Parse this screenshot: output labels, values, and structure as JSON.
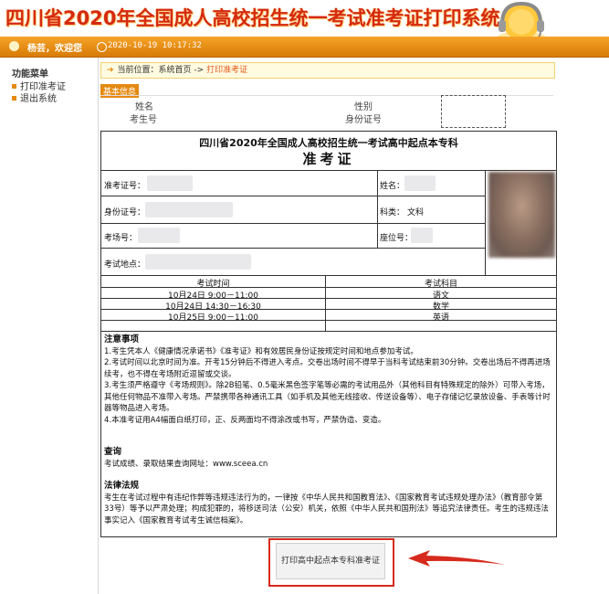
{
  "header": {
    "system_title": "四川省2020年全国成人高校招生统一考试准考证打印系统",
    "welcome": "杨芸，欢迎您",
    "datetime": "2020-10-19 10:17:32"
  },
  "sidebar": {
    "title": "功能菜单",
    "items": [
      {
        "label": "打印准考证"
      },
      {
        "label": "退出系统"
      }
    ]
  },
  "breadcrumb": {
    "prefix": "当前位置：系统首页 ->",
    "current": "打印准考证"
  },
  "basic_info": {
    "section_label": "基本信息",
    "name_label": "姓名",
    "exam_no_label": "考生号",
    "gender_label": "性别",
    "id_label": "身份证号"
  },
  "certificate": {
    "title": "四川省2020年全国成人高校招生统一考试高中起点本专科",
    "subtitle": "准考证",
    "fields": {
      "ticket_no": "准考证号：",
      "name": "姓名：",
      "id_no": "身份证号：",
      "subject_type_label": "科类：",
      "subject_type_value": "文科",
      "exam_room": "考场号：",
      "seat_no": "座位号：",
      "location": "考试地点："
    },
    "schedule": {
      "headers": [
        "考试时间",
        "考试科目"
      ],
      "rows": [
        {
          "time": "10月24日  9:00－11:00",
          "subject": "语文"
        },
        {
          "time": "10月24日  14:30－16:30",
          "subject": "数学"
        },
        {
          "time": "10月25日  9:00－11:00",
          "subject": "英语"
        }
      ]
    },
    "notes": {
      "title": "注意事项",
      "lines": [
        "1.考生凭本人《健康情况承诺书》《准考证》和有效居民身份证按规定时间和地点参加考试。",
        "2.考试时间以北京时间为准。开考15分钟后不得进入考点。交卷出场时间不得早于当科考试结束前30分钟。交卷出场后不得再进场续考，也不得在考场附近逗留或交谈。",
        "3.考生须严格遵守《考场规则》。除2B铅笔、0.5毫米黑色签字笔等必需的考试用品外（其他科目有特殊规定的除外）可带入考场，其他任何物品不准带入考场。严禁携带各种通讯工具（如手机及其他无线接收、传送设备等）、电子存储记忆录放设备、手表等计时器等物品进入考场。",
        "4.本准考证用A4幅面白纸打印，正、反两面均不得涂改或书写，严禁伪造、变造。"
      ]
    },
    "query": {
      "title": "查询",
      "text": "考试成绩、录取结果查询网址：www.sceea.cn"
    },
    "law": {
      "title": "法律法规",
      "text": "考生在考试过程中有违纪作弊等违规违法行为的，一律按《中华人民共和国教育法》、《国家教育考试违规处理办法》（教育部令第33号）等予以严肃处理；构成犯罪的，将移送司法（公安）机关，依照《中华人民共和国刑法》等追究法律责任。考生的违规违法事实记入《国家教育考试考生诚信档案》。"
    }
  },
  "print_button": {
    "label": "打印高中起点本专科准考证"
  },
  "colors": {
    "brand_orange": "#e58a12",
    "title_red": "#d52a12",
    "highlight_red": "#d62a1c"
  }
}
